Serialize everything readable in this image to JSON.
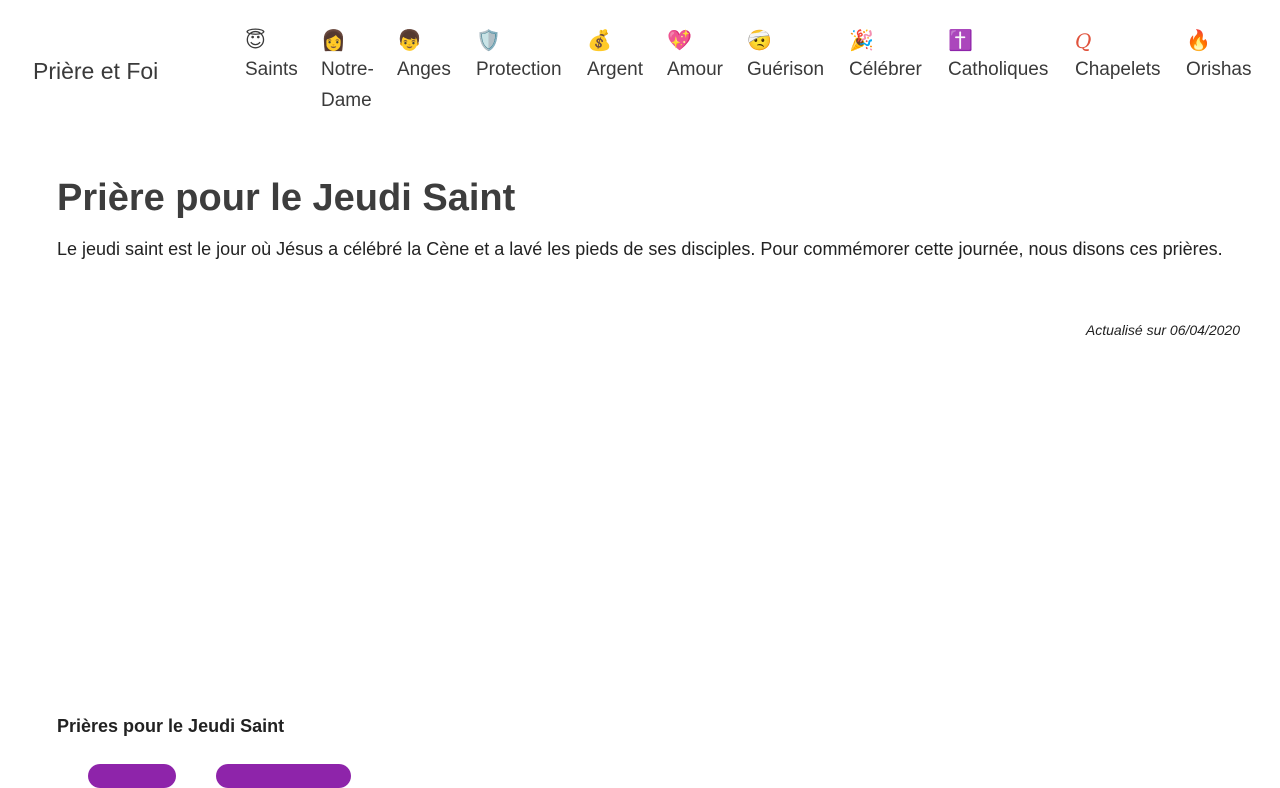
{
  "brand": "Prière et Foi",
  "nav": [
    {
      "emoji": "😇",
      "label": "Saints",
      "icon": "halo-face-icon"
    },
    {
      "emoji": "👩",
      "label": "Notre-Dame",
      "icon": "woman-icon"
    },
    {
      "emoji": "👦",
      "label": "Anges",
      "icon": "boy-icon"
    },
    {
      "emoji": "🛡️",
      "label": "Protection",
      "icon": "shield-icon"
    },
    {
      "emoji": "💰",
      "label": "Argent",
      "icon": "money-bag-icon"
    },
    {
      "emoji": "💖",
      "label": "Amour",
      "icon": "sparkling-heart-icon"
    },
    {
      "emoji": "🤕",
      "label": "Guérison",
      "icon": "bandage-face-icon"
    },
    {
      "emoji": "🎉",
      "label": "Célébrer",
      "icon": "party-popper-icon"
    },
    {
      "emoji": "✝️",
      "label": "Catholiques",
      "icon": "cross-icon"
    },
    {
      "emoji": "Q",
      "label": "Chapelets",
      "icon": "rosary-icon"
    },
    {
      "emoji": "🔥",
      "label": "Orishas",
      "icon": "fire-icon"
    }
  ],
  "page": {
    "title": "Prière pour le Jeudi Saint",
    "intro": "Le jeudi saint est le jour où Jésus a célébré la Cène et a lavé les pieds de ses disciples. Pour commémorer cette journée, nous disons ces prières.",
    "updated": "Actualisé sur 06/04/2020",
    "section_title": "Prières pour le Jeudi Saint"
  },
  "colors": {
    "accent": "#8e24aa",
    "text": "#3a3a3a"
  }
}
